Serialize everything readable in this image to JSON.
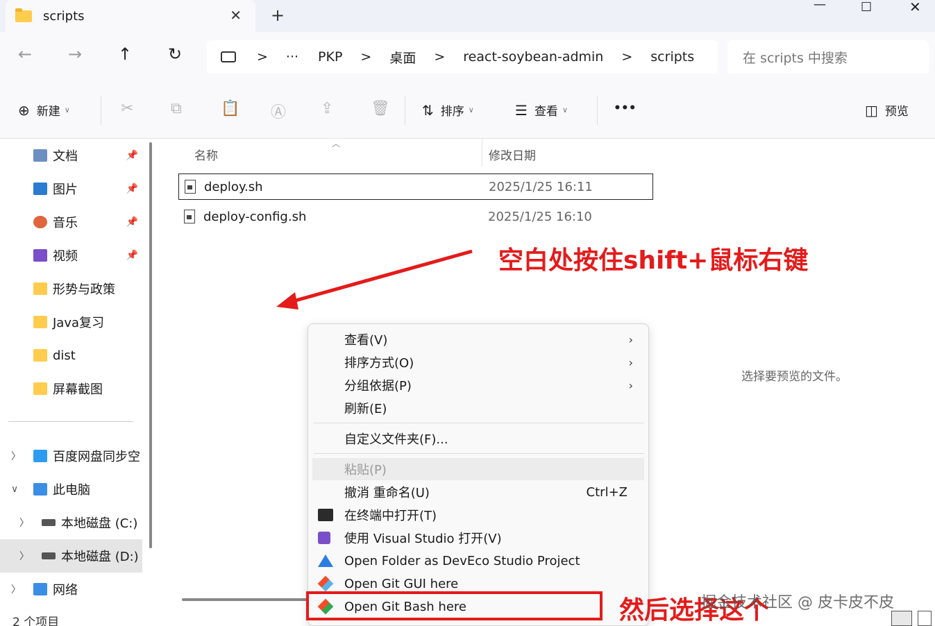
{
  "window": {
    "tab_title": "scripts",
    "close_tab": "✕",
    "new_tab": "+",
    "minimize": "—",
    "maximize": "☐",
    "close": "✕"
  },
  "nav": {
    "back": "←",
    "forward": "→",
    "up": "↑",
    "refresh": "↻"
  },
  "address": {
    "more": "···",
    "crumbs": [
      "PKP",
      "桌面",
      "react-soybean-admin",
      "scripts"
    ],
    "sep": ">"
  },
  "search": {
    "placeholder": "在 scripts 中搜索"
  },
  "toolbar": {
    "new_label": "新建",
    "sort_label": "排序",
    "view_label": "查看",
    "more": "•••",
    "preview_label": "预览"
  },
  "sidebar": {
    "items": [
      {
        "label": "文档",
        "icon": "documents-icon",
        "color": "#6d8fbf"
      },
      {
        "label": "图片",
        "icon": "pictures-icon",
        "color": "#2b7bd0"
      },
      {
        "label": "音乐",
        "icon": "music-icon",
        "color": "#e0643c"
      },
      {
        "label": "视频",
        "icon": "videos-icon",
        "color": "#7a4fc9"
      },
      {
        "label": "形势与政策",
        "icon": "folder-icon",
        "color": "#ffcc4d"
      },
      {
        "label": "Java复习",
        "icon": "folder-icon",
        "color": "#ffcc4d"
      },
      {
        "label": "dist",
        "icon": "folder-icon",
        "color": "#ffcc4d"
      },
      {
        "label": "屏幕截图",
        "icon": "folder-icon",
        "color": "#ffcc4d"
      },
      {
        "label": "百度网盘同步空",
        "icon": "baidu-netdisk-icon",
        "color": "#2e9bf0"
      },
      {
        "label": "此电脑",
        "icon": "this-pc-icon",
        "color": "#3a8ee6"
      },
      {
        "label": "本地磁盘 (C:)",
        "icon": "drive-icon",
        "color": "#555555"
      },
      {
        "label": "本地磁盘 (D:)",
        "icon": "drive-icon",
        "color": "#555555"
      },
      {
        "label": "网络",
        "icon": "network-icon",
        "color": "#3a8ee6"
      }
    ],
    "status": "2 个项目"
  },
  "columns": {
    "name": "名称",
    "modified": "修改日期"
  },
  "files": [
    {
      "name": "deploy.sh",
      "date": "2025/1/25 16:11"
    },
    {
      "name": "deploy-config.sh",
      "date": "2025/1/25 16:10"
    }
  ],
  "preview": {
    "empty_text": "选择要预览的文件。"
  },
  "context_menu": {
    "items": [
      {
        "label": "查看(V)"
      },
      {
        "label": "排序方式(O)"
      },
      {
        "label": "分组依据(P)"
      },
      {
        "label": "刷新(E)"
      },
      {
        "label": "自定义文件夹(F)..."
      },
      {
        "label": "粘贴(P)"
      },
      {
        "label": "撤消 重命名(U)",
        "shortcut": "Ctrl+Z"
      },
      {
        "label": "在终端中打开(T)"
      },
      {
        "label": "使用 Visual Studio 打开(V)"
      },
      {
        "label": "Open Folder as DevEco Studio Project"
      },
      {
        "label": "Open Git GUI here"
      },
      {
        "label": "Open Git Bash here"
      }
    ],
    "submenu_arrow": "›"
  },
  "annotations": {
    "top_note": "空白处按住shift+鼠标右键",
    "bottom_note": "然后选择这个",
    "accent": "#e41b1b"
  },
  "watermark": "掘金技术社区 @ 皮卡皮不皮"
}
